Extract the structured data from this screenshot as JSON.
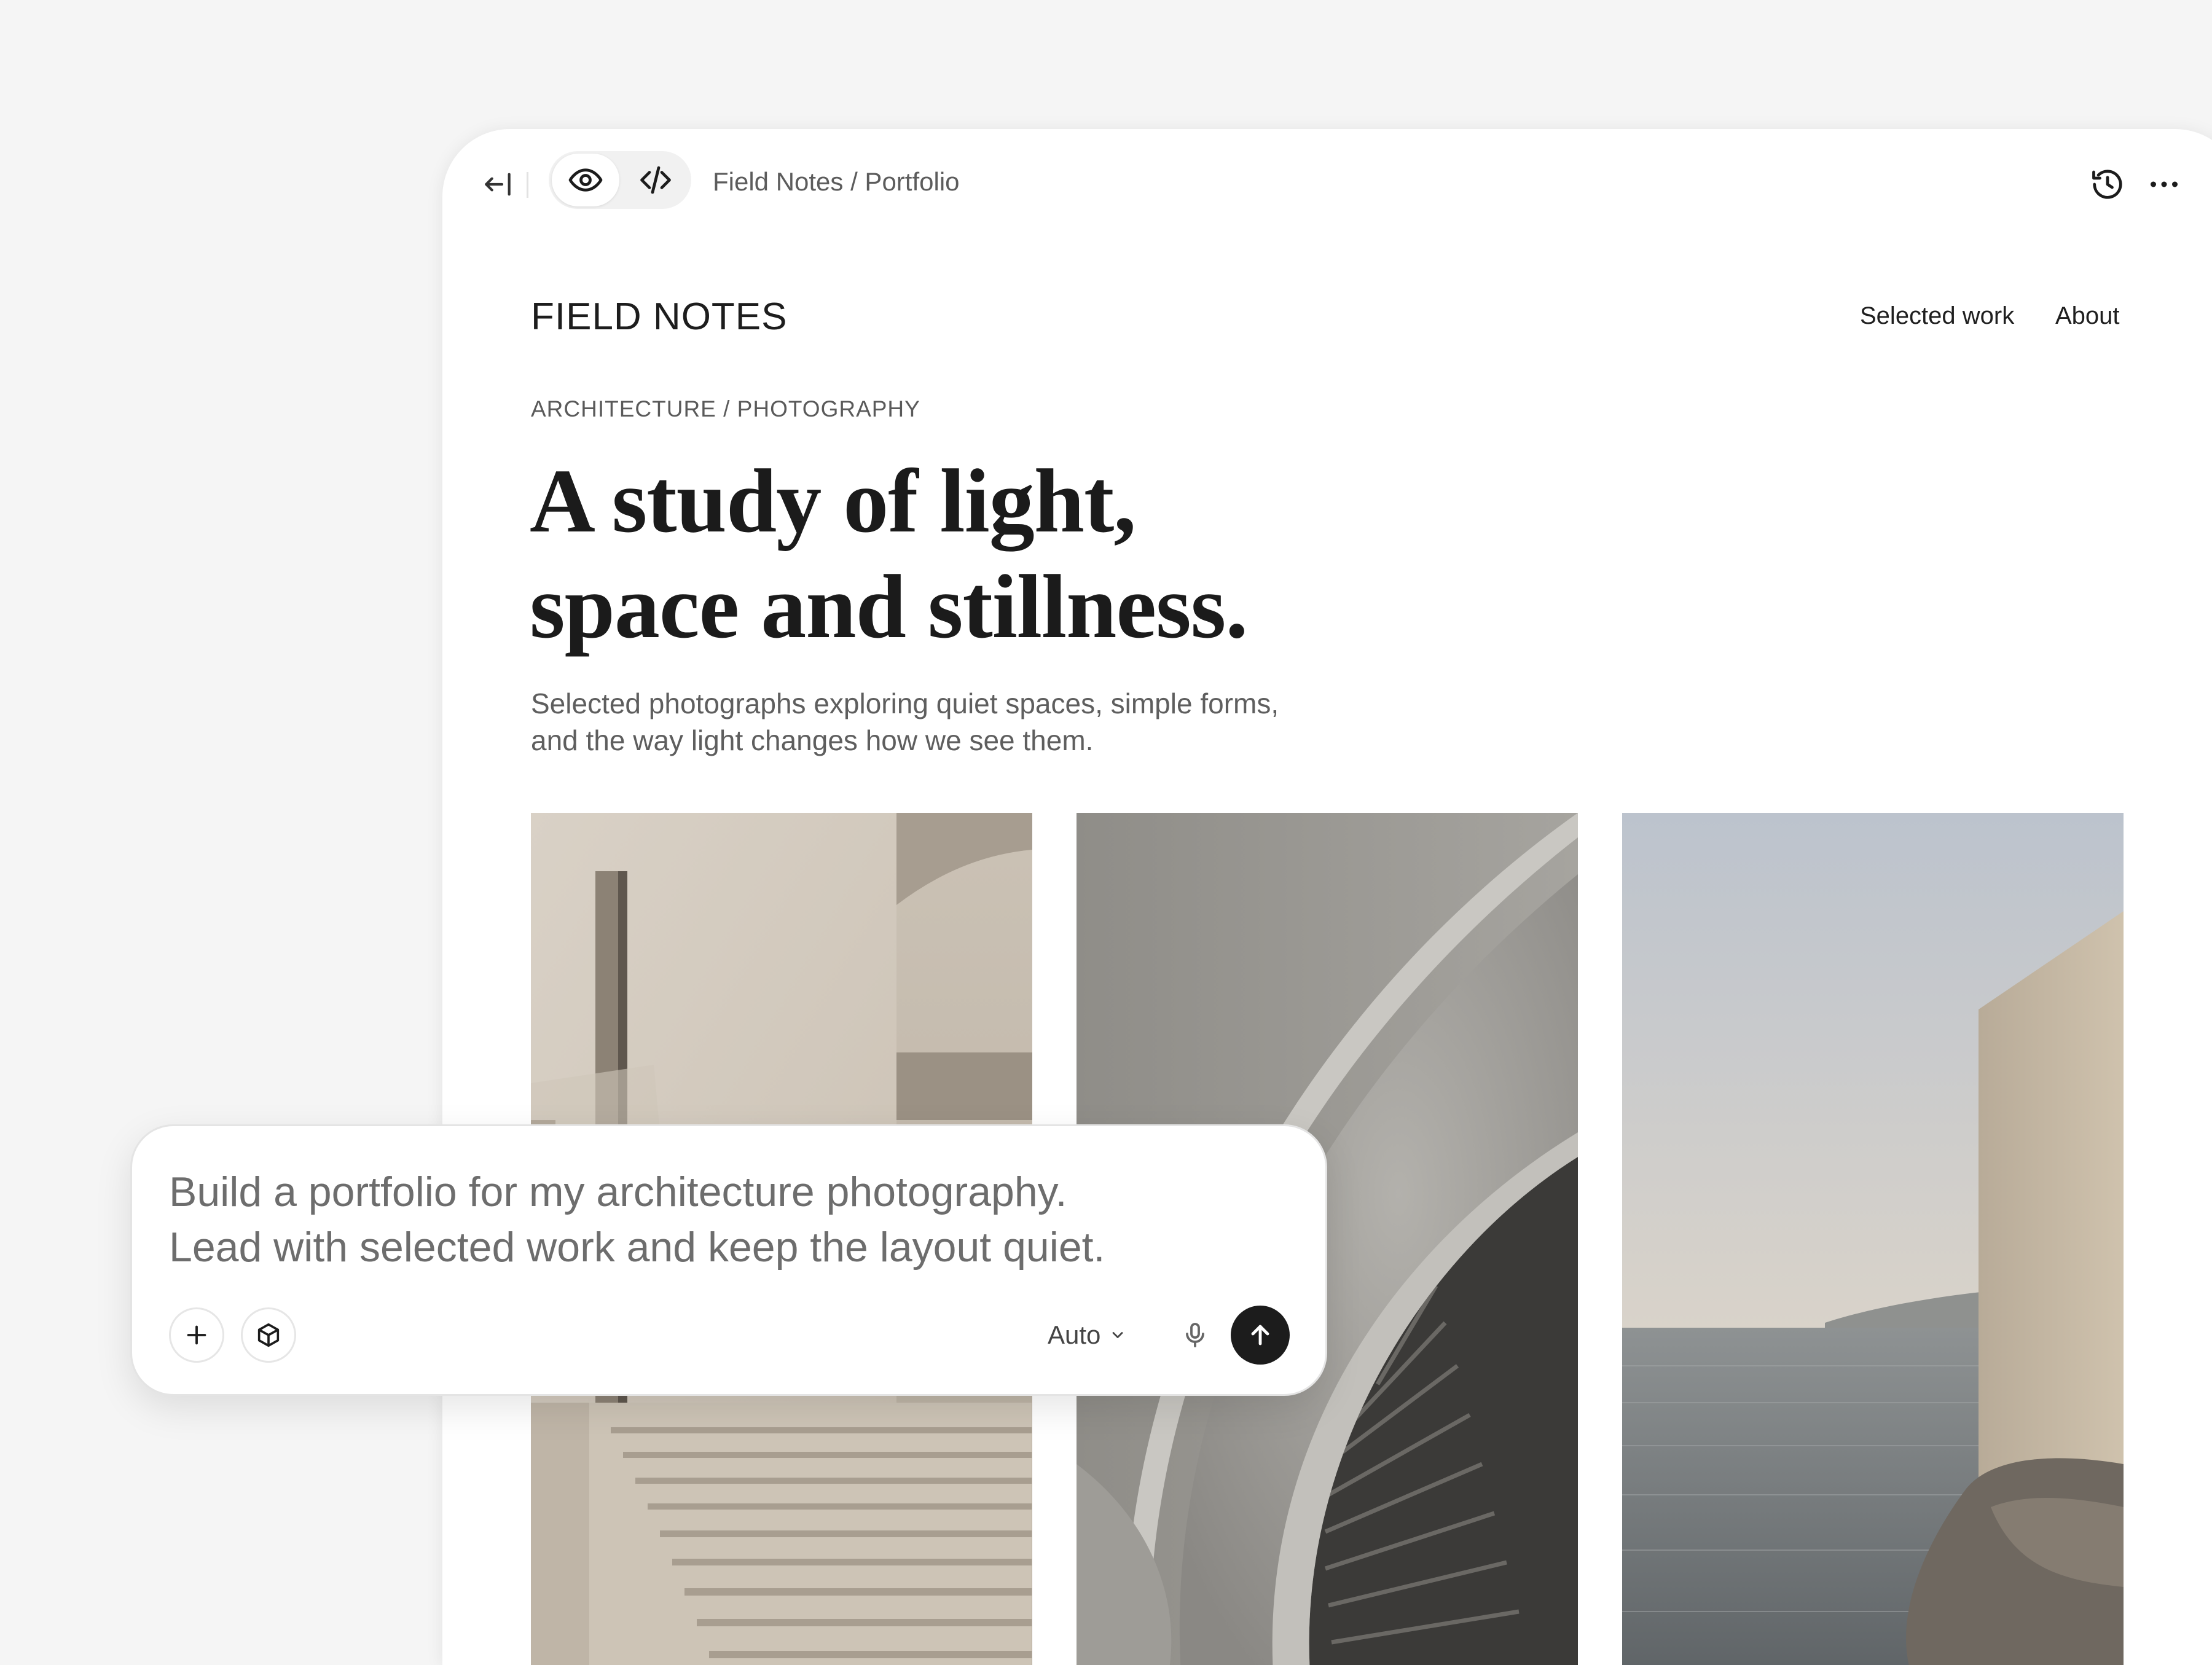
{
  "toolbar": {
    "back_icon": "collapse-left-icon",
    "preview_icon": "eye-icon",
    "code_icon": "code-icon",
    "breadcrumb": "Field Notes / Portfolio",
    "history_icon": "history-icon",
    "more_icon": "more-horizontal-icon"
  },
  "site": {
    "logo": "FIELD NOTES",
    "nav": [
      {
        "label": "Selected work"
      },
      {
        "label": "About"
      }
    ],
    "eyebrow": "ARCHITECTURE / PHOTOGRAPHY",
    "headline": [
      "A study of light,",
      "space and stillness."
    ],
    "intro": [
      "Selected photographs exploring quiet spaces, simple forms,",
      "and the way light changes how we see them."
    ],
    "photos": [
      {
        "subject": "concrete-stairway-photo"
      },
      {
        "subject": "spiral-staircase-photo"
      },
      {
        "subject": "sea-wall-photo"
      }
    ]
  },
  "composer": {
    "prompt": [
      "Build a portfolio for my architecture photography.",
      "Lead with selected work and keep the layout quiet."
    ],
    "add_icon": "plus-icon",
    "model_icon": "cube-icon",
    "mode": "Auto",
    "mic_icon": "microphone-icon",
    "send_icon": "arrow-up-icon"
  },
  "colors": {
    "canvas": "#f5f5f5",
    "window": "#ffffff",
    "text_primary": "#1b1b1b",
    "text_secondary": "#5e5e5e",
    "send_button": "#1c1c1c"
  }
}
